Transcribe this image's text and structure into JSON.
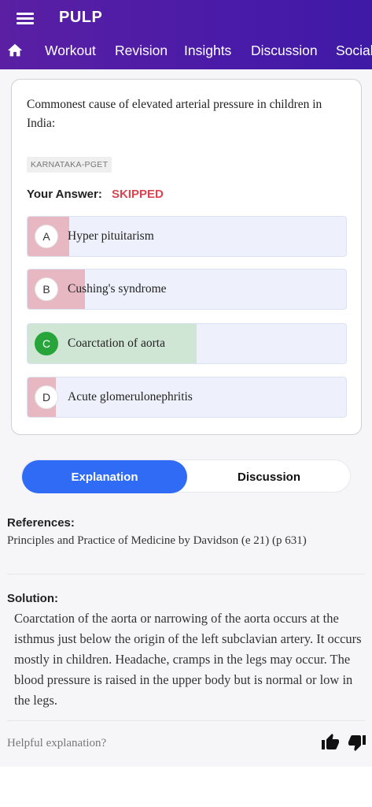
{
  "header": {
    "title": "PULP",
    "menu_icon": "hamburger-menu-icon",
    "home_icon": "home-icon",
    "nav": [
      "Workout",
      "Revision",
      "Insights",
      "Discussion",
      "Social"
    ]
  },
  "question": {
    "text": "Commonest cause of elevated arterial pressure in children in India:",
    "tag": "KARNATAKA-PGET",
    "answer_label": "Your Answer:",
    "answer_value": "SKIPPED",
    "options": [
      {
        "letter": "A",
        "text": "Hyper pituitarism",
        "percent": 13,
        "correct": false
      },
      {
        "letter": "B",
        "text": "Cushing's syndrome",
        "percent": 18,
        "correct": false
      },
      {
        "letter": "C",
        "text": "Coarctation of aorta",
        "percent": 53,
        "correct": true
      },
      {
        "letter": "D",
        "text": "Acute glomerulonephritis",
        "percent": 9,
        "correct": false
      }
    ]
  },
  "tabs": {
    "explanation": "Explanation",
    "discussion": "Discussion"
  },
  "explanation": {
    "references_title": "References:",
    "references": "Principles and Practice of Medicine by Davidson (e 21) (p 631)",
    "solution_title": "Solution:",
    "solution": "Coarctation of the aorta or narrowing of the aorta occurs at the isthmus just below the origin of the left subclavian artery. It occurs mostly in children. Headache, cramps in the legs may occur. The blood pressure is raised in the upper body but is normal or low in the legs.",
    "helpful": "Helpful explanation?"
  },
  "colors": {
    "header": "#4a1ba8",
    "wrong_fill": "#e8b8c2",
    "correct_fill": "#cfe6d4",
    "correct_badge": "#27a53a",
    "skipped": "#d94652",
    "tab_active": "#2f6bf5"
  }
}
